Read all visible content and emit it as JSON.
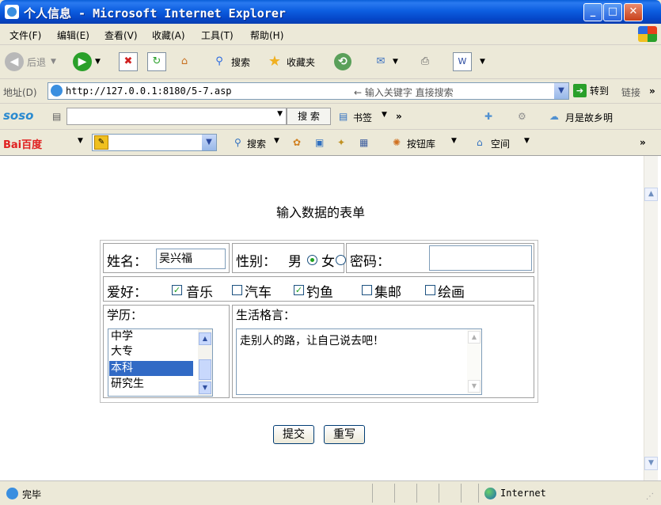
{
  "window": {
    "title": "个人信息 - Microsoft Internet Explorer",
    "min": "_",
    "max": "□",
    "close": "✕"
  },
  "menu": [
    "文件(F)",
    "编辑(E)",
    "查看(V)",
    "收藏(A)",
    "工具(T)",
    "帮助(H)"
  ],
  "toolbar": {
    "back": "后退",
    "search": "搜索",
    "favorites": "收藏夹"
  },
  "address": {
    "label": "地址(D)",
    "url": "http://127.0.0.1:8180/5-7.asp",
    "extra": "← 输入关键字 直接搜索",
    "go": "转到",
    "links": "链接"
  },
  "soso": {
    "logo": "soso",
    "search_button": "搜 索",
    "bookmarks": "书签",
    "more": "»",
    "right_text": "月是故乡明"
  },
  "baidu": {
    "logo": "Bai百度",
    "search": "搜索",
    "buttons_lib": "按钮库",
    "space": "空间"
  },
  "form": {
    "title": "输入数据的表单",
    "name_label": "姓名：",
    "name_value": "吴兴福",
    "gender_label": "性别：",
    "male": "男",
    "female": "女",
    "gender_selected": "male",
    "password_label": "密码：",
    "hobby_label": "爱好：",
    "hobbies": [
      {
        "label": "音乐",
        "checked": true
      },
      {
        "label": "汽车",
        "checked": false
      },
      {
        "label": "钓鱼",
        "checked": true
      },
      {
        "label": "集邮",
        "checked": false
      },
      {
        "label": "绘画",
        "checked": false
      }
    ],
    "education_label": "学历：",
    "education_options": [
      "中学",
      "大专",
      "本科",
      "研究生"
    ],
    "education_selected": "本科",
    "motto_label": "生活格言：",
    "motto_value": "走别人的路，让自己说去吧！",
    "submit": "提交",
    "reset": "重写"
  },
  "status": {
    "text": "完毕",
    "zone": "Internet"
  }
}
